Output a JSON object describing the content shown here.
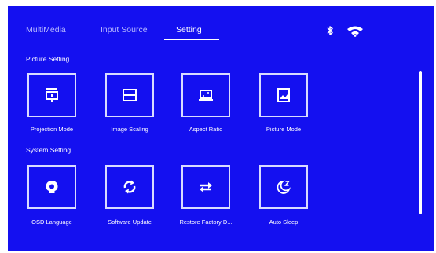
{
  "tabs": [
    {
      "label": "MultiMedia"
    },
    {
      "label": "Input Source"
    },
    {
      "label": "Setting"
    }
  ],
  "active_tab": "Setting",
  "status": {
    "bluetooth_icon": "bluetooth-icon",
    "wifi_icon": "wifi-icon"
  },
  "picture_setting": {
    "title": "Picture Setting",
    "items": [
      {
        "label": "Projection Mode",
        "icon": "projection-mode-icon"
      },
      {
        "label": "Image Scaling",
        "icon": "image-scaling-icon"
      },
      {
        "label": "Aspect Ratio",
        "icon": "aspect-ratio-icon"
      },
      {
        "label": "Picture Mode",
        "icon": "picture-mode-icon"
      }
    ]
  },
  "system_setting": {
    "title": "System Setting",
    "items": [
      {
        "label": "OSD Language",
        "icon": "osd-language-icon"
      },
      {
        "label": "Software Update",
        "icon": "software-update-icon"
      },
      {
        "label": "Restore Factory D...",
        "icon": "restore-factory-icon"
      },
      {
        "label": "Auto Sleep",
        "icon": "auto-sleep-icon"
      }
    ]
  },
  "colors": {
    "background": "#1410f0",
    "inactive_tab": "#b7b9ff",
    "text": "#ffffff"
  }
}
